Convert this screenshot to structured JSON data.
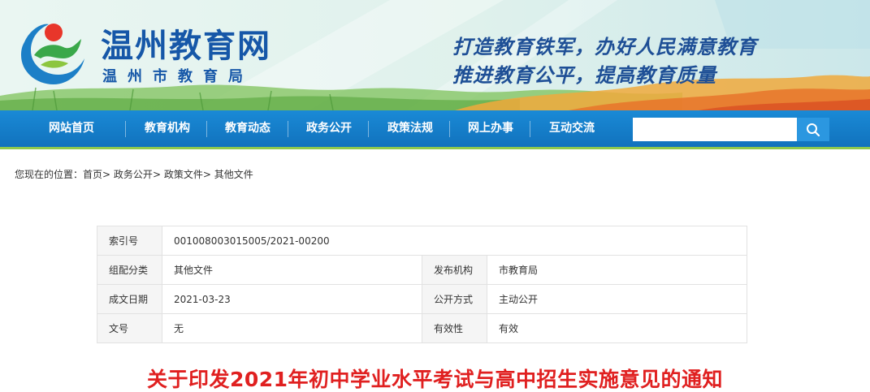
{
  "header": {
    "site_title": "温州教育网",
    "site_subtitle": "温州市教育局",
    "slogan_line1": "打造教育铁军，办好人民满意教育",
    "slogan_line2": "推进教育公平，提高教育质量"
  },
  "nav": {
    "items": [
      {
        "label": "网站首页"
      },
      {
        "label": "教育机构"
      },
      {
        "label": "教育动态"
      },
      {
        "label": "政务公开"
      },
      {
        "label": "政策法规"
      },
      {
        "label": "网上办事"
      },
      {
        "label": "互动交流"
      }
    ],
    "search": {
      "value": "",
      "icon": "search-icon"
    }
  },
  "breadcrumb": {
    "prefix": "您现在的位置：",
    "items": [
      "首页",
      "政务公开",
      "政策文件",
      "其他文件"
    ],
    "separator": ">"
  },
  "info": {
    "index_label": "索引号",
    "index_value": "001008003015005/2021-00200",
    "category_label": "组配分类",
    "category_value": "其他文件",
    "publisher_label": "发布机构",
    "publisher_value": "市教育局",
    "date_label": "成文日期",
    "date_value": "2021-03-23",
    "disclosure_label": "公开方式",
    "disclosure_value": "主动公开",
    "docno_label": "文号",
    "docno_value": "无",
    "validity_label": "有效性",
    "validity_value": "有效"
  },
  "document": {
    "title": "关于印发2021年初中学业水平考试与高中招生实施意见的通知"
  },
  "colors": {
    "nav_blue": "#1172bd",
    "nav_accent_green": "#8fc94c",
    "title_blue": "#1657a8",
    "doc_title_red": "#e02020"
  }
}
